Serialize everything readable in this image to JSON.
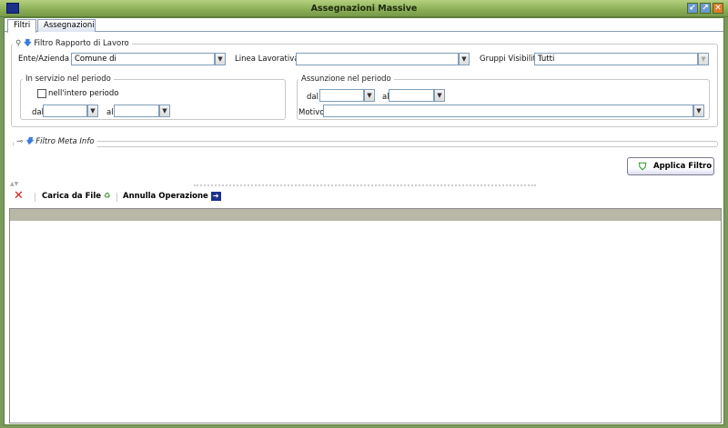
{
  "window": {
    "title": "Assegnazioni Massive",
    "buttons": [
      "minimize",
      "maximize",
      "close"
    ]
  },
  "tabs": [
    {
      "label": "Filtri",
      "active": true
    },
    {
      "label": "Assegnazioni",
      "active": false
    }
  ],
  "filtro_rapporto": {
    "legend": "Filtro Rapporto di Lavoro",
    "ente_label": "Ente/Azienda",
    "ente_value": "Comune di",
    "linea_label": "Linea Lavorativa",
    "linea_value": "",
    "gruppi_label": "Gruppi Visibilità",
    "gruppi_value": "Tutti",
    "in_servizio": {
      "legend": "In servizio nel periodo",
      "checkbox_label": "nell'intero periodo",
      "checked": false,
      "dal_label": "dal",
      "dal_value": "",
      "al_label": "al",
      "al_value": ""
    },
    "assunzione": {
      "legend": "Assunzione nel periodo",
      "dal_label": "dal",
      "dal_value": "",
      "al_label": "al",
      "al_value": "",
      "motivo_label": "Motivo",
      "motivo_value": ""
    }
  },
  "filtro_meta": {
    "legend": "Filtro Meta Info"
  },
  "applica_label": "Applica Filtro",
  "toolbar": {
    "carica_label": "Carica da File",
    "annulla_label": "Annulla Operazione"
  }
}
